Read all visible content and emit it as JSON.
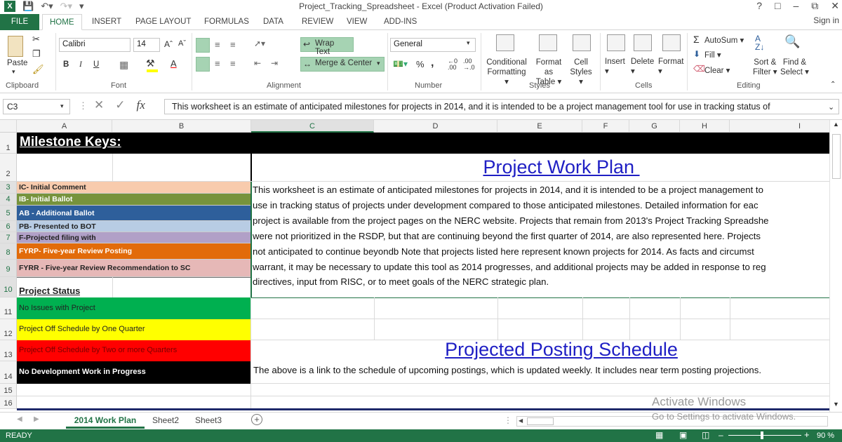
{
  "window": {
    "title": "Project_Tracking_Spreadsheet - Excel (Product Activation Failed)",
    "help": "?",
    "controls": [
      "□",
      "–",
      "⧉",
      "✕"
    ]
  },
  "ribbon_tabs": [
    "FILE",
    "HOME",
    "INSERT",
    "PAGE LAYOUT",
    "FORMULAS",
    "DATA",
    "REVIEW",
    "VIEW",
    "ADD-INS"
  ],
  "sign_in": "Sign in",
  "clipboard": {
    "paste": "Paste",
    "label": "Clipboard"
  },
  "font": {
    "name": "Calibri",
    "size": "14",
    "label": "Font",
    "bold": "B",
    "italic": "I",
    "underline": "U"
  },
  "alignment": {
    "wrap": "Wrap Text",
    "merge": "Merge & Center",
    "label": "Alignment"
  },
  "number": {
    "format": "General",
    "pct": "%",
    "comma": ",",
    "label": "Number"
  },
  "styles": {
    "conditional": [
      "Conditional",
      "Formatting"
    ],
    "format_table": [
      "Format as",
      "Table"
    ],
    "cell_styles": [
      "Cell",
      "Styles"
    ],
    "label": "Styles"
  },
  "cells": {
    "insert": "Insert",
    "delete": "Delete",
    "format": "Format",
    "label": "Cells"
  },
  "editing": {
    "autosum": "AutoSum",
    "fill": "Fill",
    "clear": "Clear",
    "sort": [
      "Sort &",
      "Filter"
    ],
    "find": [
      "Find &",
      "Select"
    ],
    "label": "Editing"
  },
  "formula_bar": {
    "name_box": "C3",
    "content": "This worksheet is an estimate of anticipated milestones for projects in 2014, and it is intended to be a project management tool for use in tracking status of"
  },
  "columns": [
    "A",
    "B",
    "C",
    "D",
    "E",
    "F",
    "G",
    "H",
    "I"
  ],
  "rows": [
    "1",
    "2",
    "3",
    "4",
    "5",
    "6",
    "7",
    "8",
    "9",
    "10",
    "11",
    "12",
    "13",
    "14",
    "15",
    "16"
  ],
  "sheet": {
    "milestone_header": "Milestone Keys:",
    "milestone_keys": [
      {
        "label": "IC- Initial Comment",
        "color": "#f8cbad"
      },
      {
        "label": "IB- Initial Ballot",
        "color": "#77933c"
      },
      {
        "label": "AB - Additional Ballot",
        "color": "#2e5f9b"
      },
      {
        "label": "PB- Presented to BOT",
        "color": "#b8cce4"
      },
      {
        "label": "F-Projected filing with",
        "color": "#b1a0c7"
      },
      {
        "label": "FYRP- Five-year Review Posting",
        "color": "#e26b0a"
      },
      {
        "label": "FYRR - Five-year Review Recommendation to SC",
        "color": "#e6b8b7"
      }
    ],
    "status_header": "Project Status",
    "status_keys": [
      {
        "label": "No Issues with Project",
        "color": "#00b050"
      },
      {
        "label": "Project Off Schedule by One Quarter",
        "color": "#ffff00"
      },
      {
        "label": "Project Off Schedule by Two or more Quarters",
        "color": "#ff0000"
      },
      {
        "label": "No Development Work in Progress",
        "color": "#000000"
      }
    ],
    "plan_title": "Project Work Plan ",
    "intro_lines": [
      "This worksheet is an estimate of anticipated milestones for projects in 2014, and it is intended to be a project management to",
      "use in tracking status of projects under development compared to those anticipated milestones.  Detailed information for eac",
      "project is available from the project pages on the NERC website.  Projects that remain from 2013's Project Tracking Spreadshe",
      "were not prioritized in the RSDP, but that are continuing beyond the first quarter of 2014, are also represented here.  Projects",
      "not anticipated to continue beyondb  Note that projects listed here represent known projects for 2014.  As facts and circumst",
      "warrant, it may be necessary to update this tool as 2014 progresses, and additional projects may be added in response to reg",
      "directives, input from RISC, or to meet goals of the NERC strategic plan."
    ],
    "posting_link": "Projected Posting Schedule",
    "posting_note": "The above is a link to the schedule of upcoming postings, which is updated weekly.  It includes near term posting projections."
  },
  "sheet_tabs": [
    "2014 Work Plan",
    "Sheet2",
    "Sheet3"
  ],
  "add_sheet": "+",
  "status_bar": {
    "state": "READY",
    "zoom": "90 %"
  },
  "watermark": {
    "line1": "Activate Windows",
    "line2": "Go to Settings to activate Windows."
  }
}
